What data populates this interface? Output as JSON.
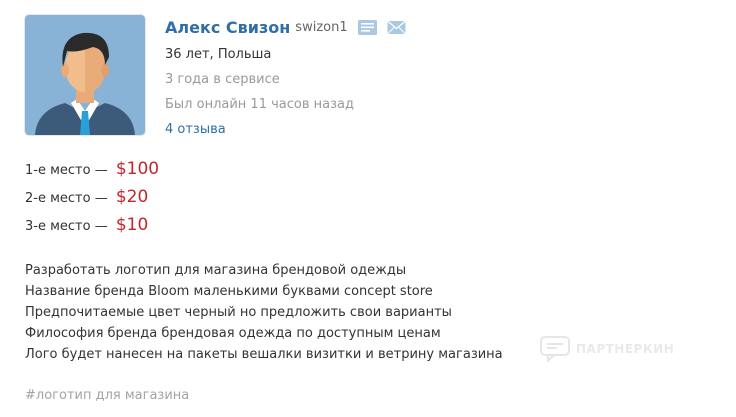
{
  "profile": {
    "name": "Алекс Свизон",
    "login": "swizon1",
    "age_location": "36 лет, Польша",
    "service_time": "3 года в сервисе",
    "last_online": "Был онлайн 11 часов назад",
    "reviews": "4 отзыва"
  },
  "icons": {
    "profile_card": "id-card-icon",
    "message": "envelope-icon"
  },
  "colors": {
    "link": "#2f6ea7",
    "prize_amount": "#c0272d",
    "muted": "#999999",
    "icon": "#a9c9e3"
  },
  "prizes": [
    {
      "place": "1-е место —",
      "amount": "$100"
    },
    {
      "place": "2-е место —",
      "amount": "$20"
    },
    {
      "place": "3-е место —",
      "amount": "$10"
    }
  ],
  "description": [
    "Разработать логотип для магазина брендовой одежды",
    "Название бренда Bloom маленькими буквами concept store",
    "Предпочитаемые цвет черный но предложить свои варианты",
    "Философия бренда брендовая одежда по доступным ценам",
    "Лого будет нанесен на пакеты вешалки визитки и ветрину магазина"
  ],
  "tag": "#логотип для магазина",
  "watermark": "ПАРТНЕРКИН"
}
